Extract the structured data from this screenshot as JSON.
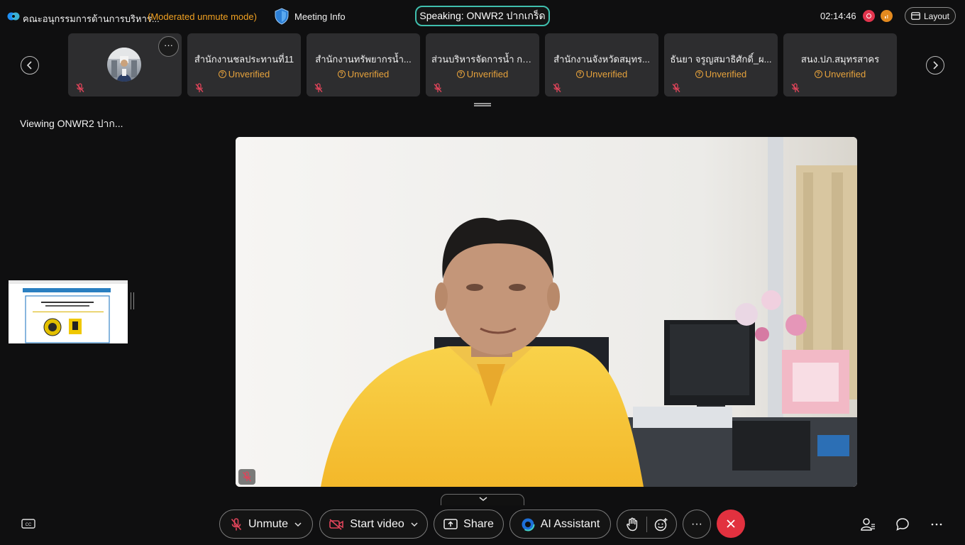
{
  "topbar": {
    "meeting_title": "คณะอนุกรรมการด้านการบริหาร...",
    "mode": "(Moderated unmute mode)",
    "meeting_info": "Meeting Info",
    "speaking": "Speaking: ONWR2 ปากเกร็ด",
    "clock": "02:14:46",
    "layout": "Layout"
  },
  "participants": [
    {
      "name": "",
      "status": "",
      "has_avatar": true
    },
    {
      "name": "สำนักงานชลประทานที่11",
      "status": "Unverified"
    },
    {
      "name": "สำนักงานทรัพยากรน้ำ...",
      "status": "Unverified"
    },
    {
      "name": "ส่วนบริหารจัดการน้ำ กร...",
      "status": "Unverified"
    },
    {
      "name": "สำนักงานจังหวัดสมุทร...",
      "status": "Unverified"
    },
    {
      "name": "ธันยา จรูญสมาธิศักดิ์_ผ...",
      "status": "Unverified"
    },
    {
      "name": "สนง.ปภ.สมุทรสาคร",
      "status": "Unverified"
    }
  ],
  "tile_more": "···",
  "viewing": "Viewing ONWR2 ปาก...",
  "toolbar": {
    "unmute": "Unmute",
    "start_video": "Start video",
    "share": "Share",
    "ai_assistant": "AI Assistant",
    "more": "···"
  },
  "colors": {
    "accent_teal": "#3fbfae",
    "warning_orange": "#f0a021",
    "end_red": "#e2313f",
    "mute_red": "#e0445a"
  }
}
